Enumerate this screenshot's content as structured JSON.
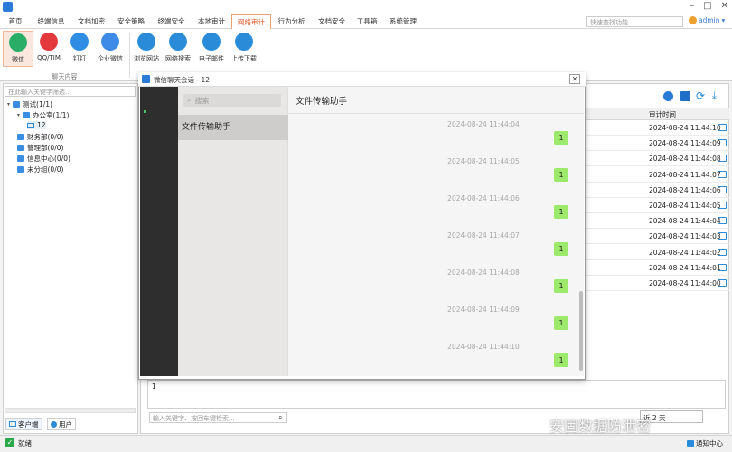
{
  "menu": [
    "首页",
    "终端信息",
    "文档加密",
    "安全策略",
    "终端安全",
    "本地审计",
    "网络审计",
    "行为分析",
    "文档安全",
    "工具箱",
    "系统管理"
  ],
  "menu_active_index": 6,
  "quick_search_placeholder": "快速查找功能",
  "user": "admin",
  "ribbon": {
    "items": [
      {
        "label": "微信",
        "icon": "wechat-icon",
        "color": "#2aae67"
      },
      {
        "label": "QQ/TIM",
        "icon": "qq-icon",
        "color": "#e4393c"
      },
      {
        "label": "钉钉",
        "icon": "dingtalk-icon",
        "color": "#2f8de4"
      },
      {
        "label": "企业微信",
        "icon": "wecom-icon",
        "color": "#3d8be6"
      },
      {
        "label": "浏览网站",
        "icon": "globe-icon",
        "color": "#2a8cd8"
      },
      {
        "label": "网络搜索",
        "icon": "web-search-icon",
        "color": "#2a8cd8"
      },
      {
        "label": "电子邮件",
        "icon": "mail-icon",
        "color": "#2a8cd8"
      },
      {
        "label": "上传下载",
        "icon": "cloud-transfer-icon",
        "color": "#2a8cd8"
      }
    ],
    "group_caption": "聊天内容"
  },
  "left_panel": {
    "search_placeholder": "在此输入关键字筛选...",
    "tree": [
      {
        "label": "测试(1/1)",
        "level": 0,
        "expanded": true
      },
      {
        "label": "办公室(1/1)",
        "level": 1,
        "expanded": true
      },
      {
        "label": "12",
        "level": 2,
        "type": "computer"
      },
      {
        "label": "财务部(0/0)",
        "level": 1
      },
      {
        "label": "管理部(0/0)",
        "level": 1
      },
      {
        "label": "信息中心(0/0)",
        "level": 1
      },
      {
        "label": "未分组(0/0)",
        "level": 1
      }
    ],
    "tabs": [
      "客户端",
      "用户"
    ]
  },
  "table": {
    "header": "审计时间",
    "rows": [
      "2024-08-24 11:44:10",
      "2024-08-24 11:44:09",
      "2024-08-24 11:44:08",
      "2024-08-24 11:44:07",
      "2024-08-24 11:44:06",
      "2024-08-24 11:44:05",
      "2024-08-24 11:44:04",
      "2024-08-24 11:44:03",
      "2024-08-24 11:44:02",
      "2024-08-24 11:44:01",
      "2024-08-24 11:44:00"
    ]
  },
  "detail_text": "1",
  "keyword_placeholder": "输入关键字、按回车键检索...",
  "pager": "近 2 天",
  "status": {
    "text": "就绪",
    "notify": "通知中心"
  },
  "watermark": "安固数据防泄密",
  "dialog": {
    "title": "微信聊天会话 - 12",
    "search_placeholder": "搜索",
    "conversation": "文件传输助手",
    "messages": [
      {
        "time": "2024-08-24 11:44:04",
        "text": "1"
      },
      {
        "time": "2024-08-24 11:44:05",
        "text": "1"
      },
      {
        "time": "2024-08-24 11:44:06",
        "text": "1"
      },
      {
        "time": "2024-08-24 11:44:07",
        "text": "1"
      },
      {
        "time": "2024-08-24 11:44:08",
        "text": "1"
      },
      {
        "time": "2024-08-24 11:44:09",
        "text": "1"
      },
      {
        "time": "2024-08-24 11:44:10",
        "text": "1"
      }
    ]
  }
}
